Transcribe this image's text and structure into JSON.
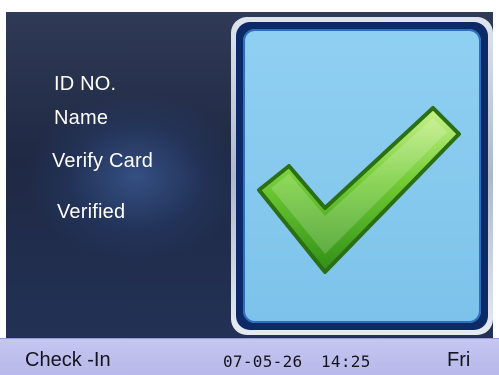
{
  "info": {
    "id_label": "ID NO.",
    "name_label": "Name",
    "verify_label": "Verify Card",
    "status_text": "Verified"
  },
  "status_bar": {
    "mode": "Check -In",
    "date": "07-05-26",
    "time": "14:25",
    "day": "Fri"
  },
  "icons": {
    "result": "checkmark-icon"
  },
  "colors": {
    "screen_bg": "#223155",
    "panel_blue": "#8fd0f2",
    "check_green": "#5fc02b",
    "status_bar_bg": "#c6c6f2"
  }
}
